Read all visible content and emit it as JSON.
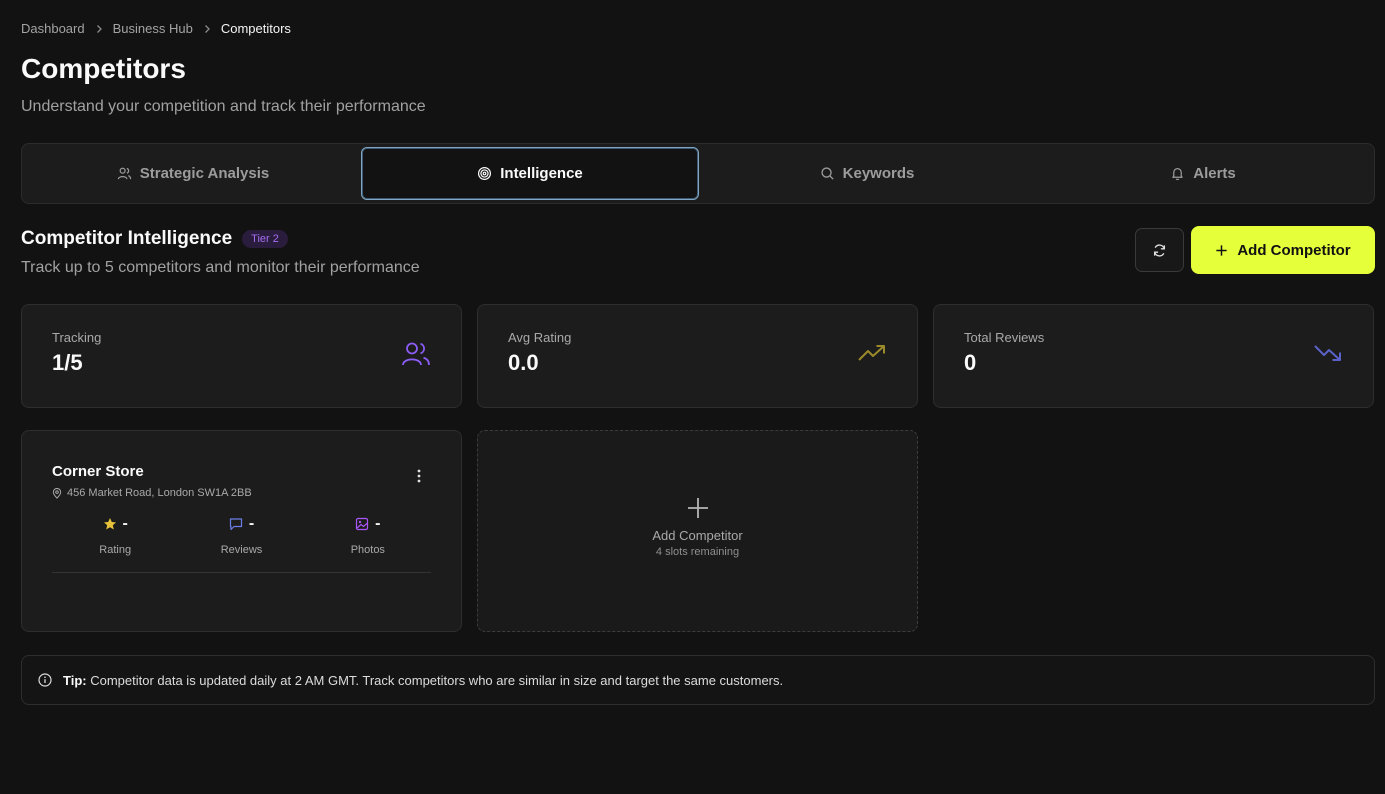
{
  "breadcrumb": {
    "items": [
      "Dashboard",
      "Business Hub",
      "Competitors"
    ]
  },
  "header": {
    "title": "Competitors",
    "subtitle": "Understand your competition and track their performance"
  },
  "tabs": [
    {
      "label": "Strategic Analysis",
      "icon": "users-icon",
      "active": false
    },
    {
      "label": "Intelligence",
      "icon": "target-icon",
      "active": true
    },
    {
      "label": "Keywords",
      "icon": "search-icon",
      "active": false
    },
    {
      "label": "Alerts",
      "icon": "bell-icon",
      "active": false
    }
  ],
  "section": {
    "title": "Competitor Intelligence",
    "tier": "Tier 2",
    "subtitle": "Track up to 5 competitors and monitor their performance",
    "add_button": "Add Competitor"
  },
  "stats": [
    {
      "label": "Tracking",
      "value": "1/5",
      "icon": "users-icon",
      "color": "#8b5cf6"
    },
    {
      "label": "Avg Rating",
      "value": "0.0",
      "icon": "trending-up-icon",
      "color": "#9a8a2a"
    },
    {
      "label": "Total Reviews",
      "value": "0",
      "icon": "trending-down-icon",
      "color": "#5a62c8"
    }
  ],
  "competitor": {
    "name": "Corner Store",
    "address": "456 Market Road, London SW1A 2BB",
    "metrics": [
      {
        "value": "-",
        "label": "Rating",
        "icon": "star-icon",
        "color": "#e8c23a"
      },
      {
        "value": "-",
        "label": "Reviews",
        "icon": "message-icon",
        "color": "#6b7ee8"
      },
      {
        "value": "-",
        "label": "Photos",
        "icon": "image-icon",
        "color": "#a855f7"
      }
    ]
  },
  "add_card": {
    "title": "Add Competitor",
    "slots": "4 slots remaining"
  },
  "tip": {
    "prefix": "Tip:",
    "text": " Competitor data is updated daily at 2 AM GMT. Track competitors who are similar in size and target the same customers."
  }
}
